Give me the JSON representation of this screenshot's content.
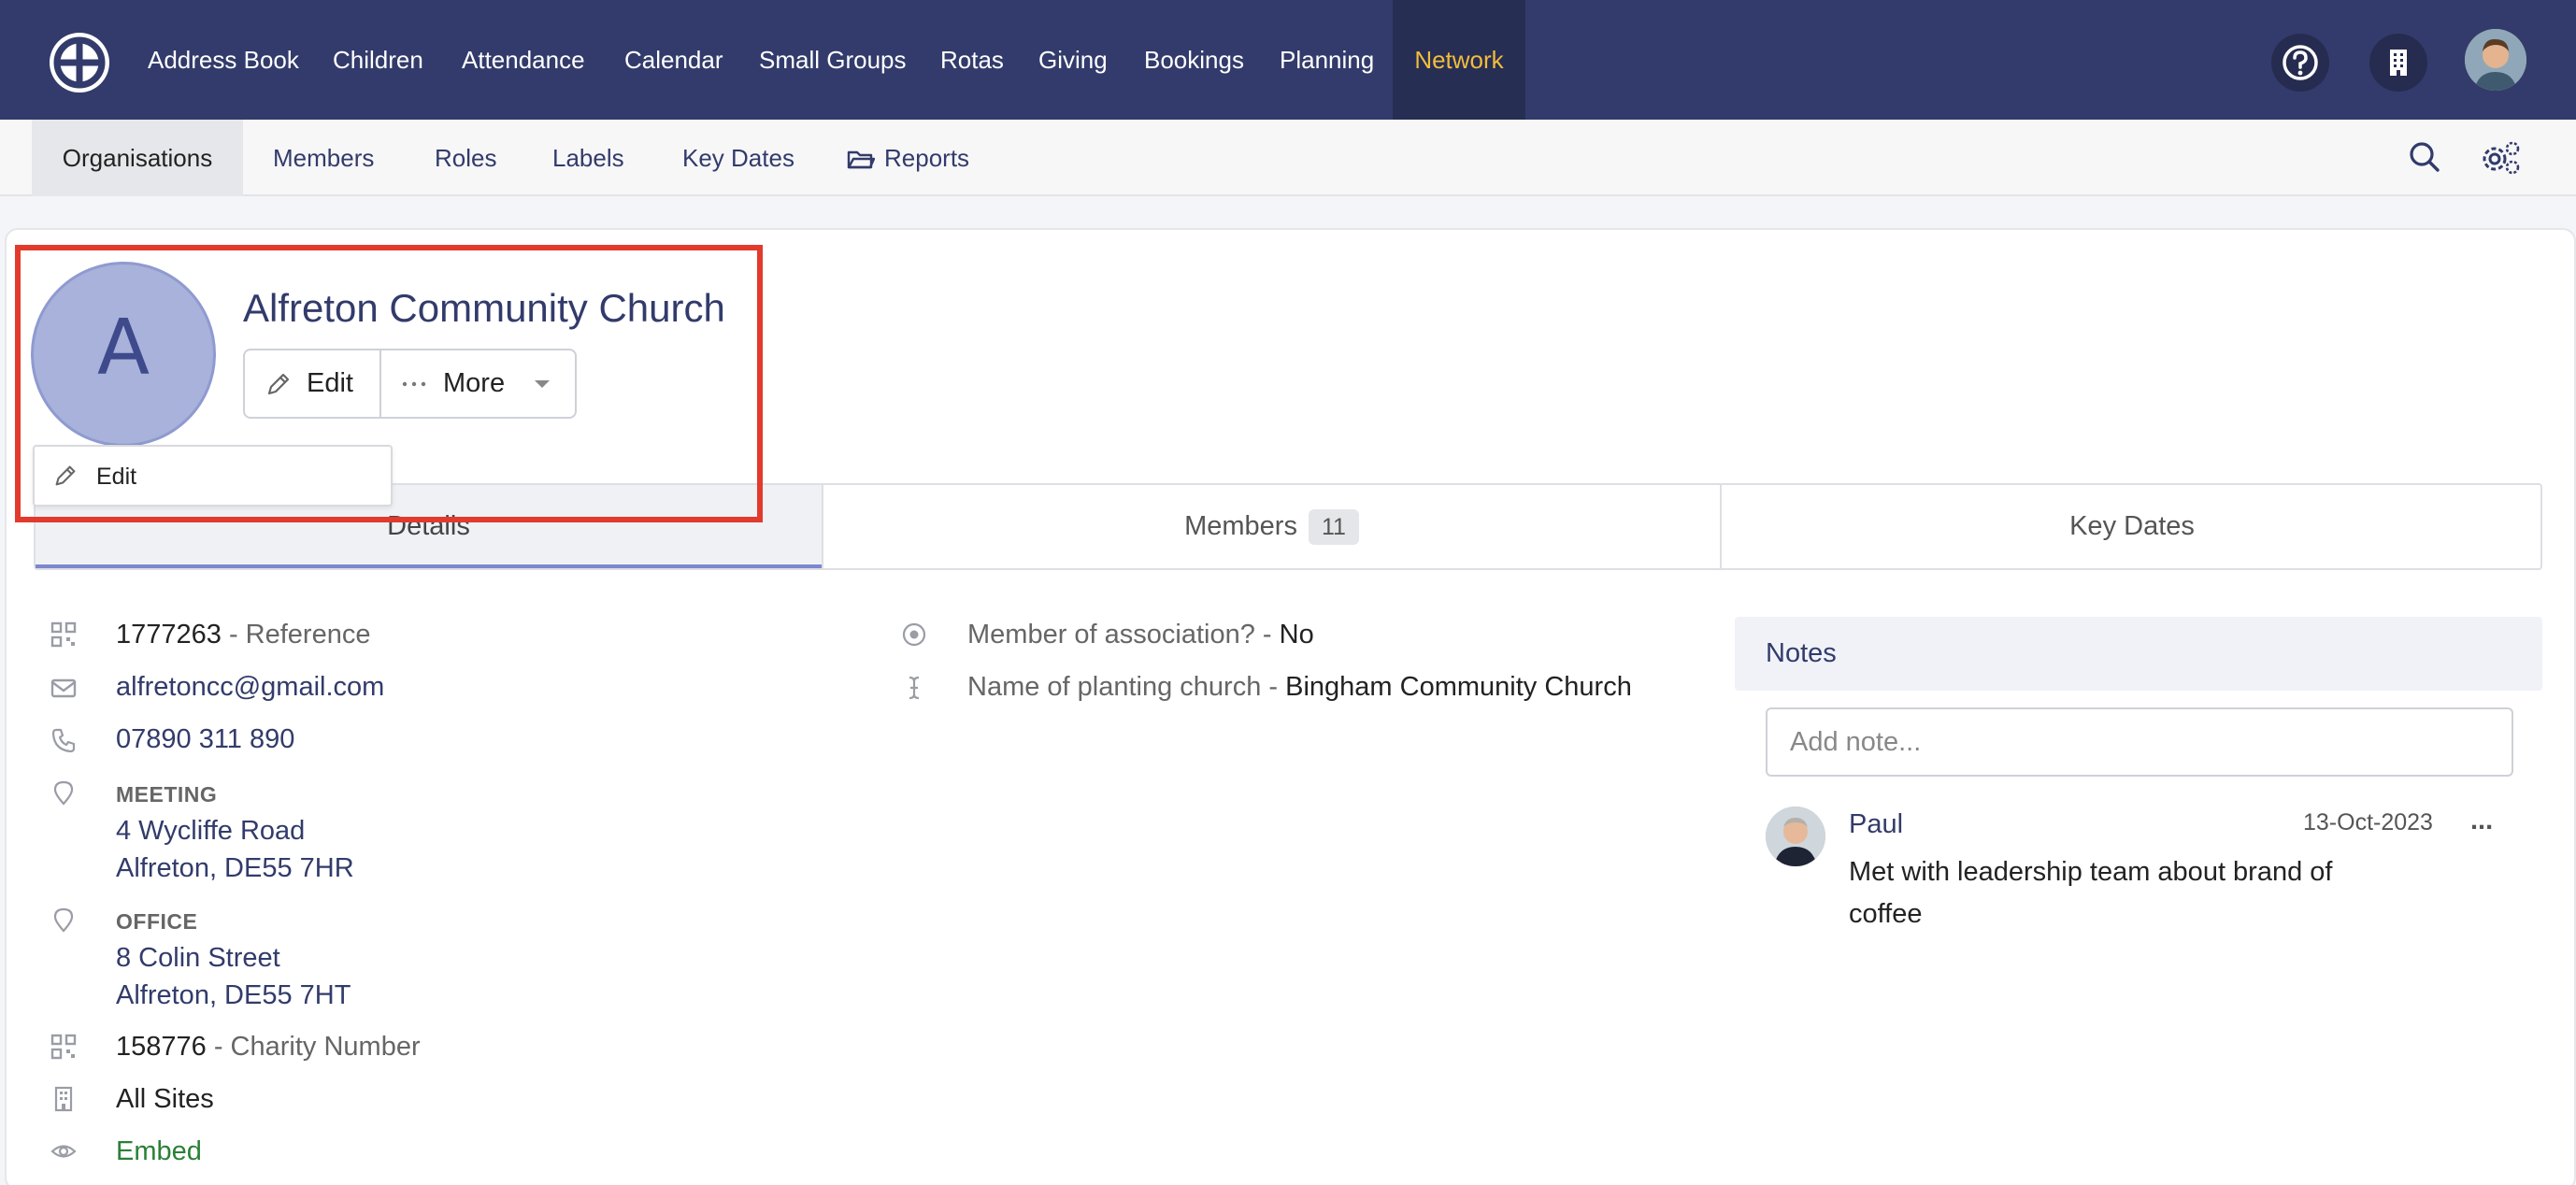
{
  "topnav": {
    "items": [
      "Address Book",
      "Children",
      "Attendance",
      "Calendar",
      "Small Groups",
      "Rotas",
      "Giving",
      "Bookings",
      "Planning",
      "Network"
    ],
    "active": "Network",
    "accent_color": "#f2bd3b",
    "background_color": "#323b6b",
    "icons": [
      "help-icon",
      "building-icon",
      "user-avatar"
    ]
  },
  "subnav": {
    "items": [
      "Organisations",
      "Members",
      "Roles",
      "Labels",
      "Key Dates"
    ],
    "reports": "Reports",
    "active": "Organisations",
    "icons": [
      "folder-icon",
      "search-icon",
      "settings-icon"
    ]
  },
  "org": {
    "avatar_letter": "A",
    "name": "Alfreton Community Church",
    "edit_label": "Edit",
    "more_label": "More",
    "dropdown_edit": "Edit"
  },
  "tabs": {
    "details": "Details",
    "members": "Members",
    "members_count": "11",
    "key_dates": "Key Dates"
  },
  "details": {
    "reference_value": "1777263",
    "reference_label": " - Reference",
    "email": "alfretoncc@gmail.com",
    "phone": "07890 311 890",
    "meeting_label": "MEETING",
    "meeting_line1": "4 Wycliffe Road",
    "meeting_line2": "Alfreton, DE55 7HR",
    "office_label": "OFFICE",
    "office_line1": "8 Colin Street",
    "office_line2": "Alfreton, DE55 7HT",
    "charity_value": "158776",
    "charity_label": " - Charity Number",
    "sites": "All Sites",
    "embed": "Embed"
  },
  "custom_fields": {
    "association_label": "Member of association? - ",
    "association_value": "No",
    "planting_label": "Name of planting church - ",
    "planting_value": "Bingham Community Church"
  },
  "notes": {
    "title": "Notes",
    "placeholder": "Add note...",
    "entries": [
      {
        "author": "Paul",
        "date": "13-Oct-2023",
        "menu": "...",
        "text_line1": "Met with leadership team about brand of",
        "text_line2": "coffee"
      }
    ]
  }
}
